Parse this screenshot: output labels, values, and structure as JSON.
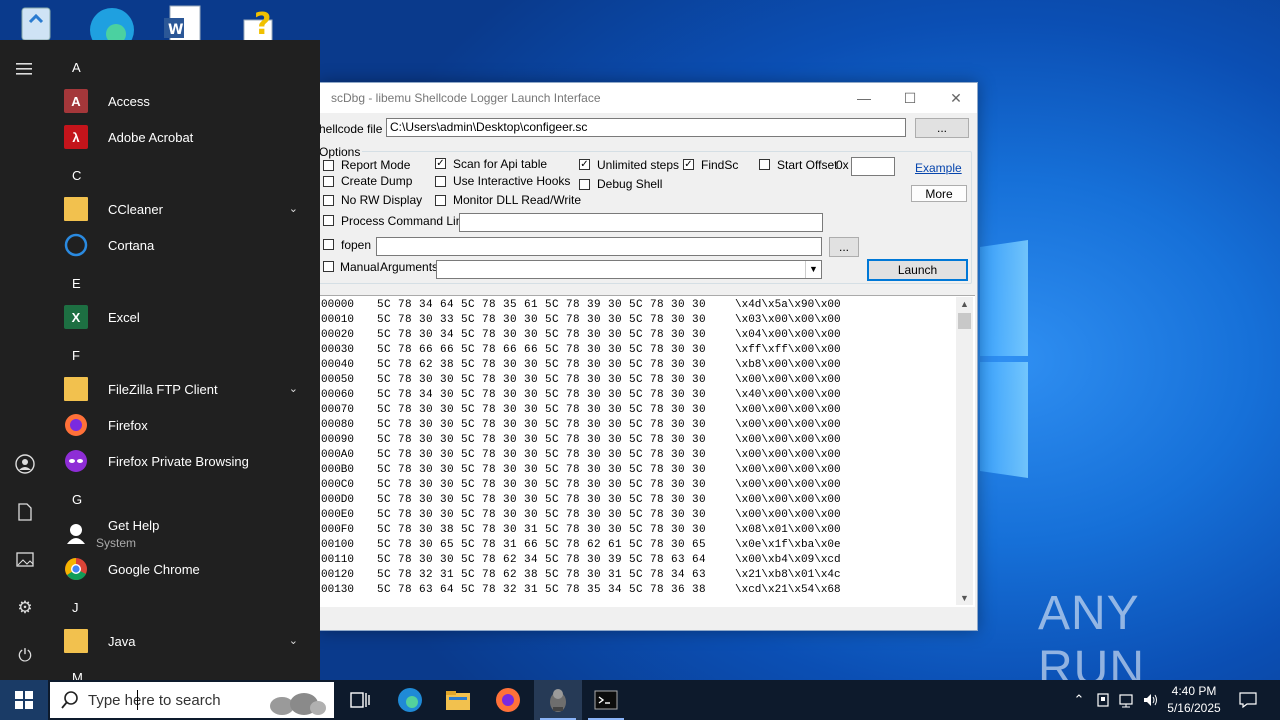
{
  "window": {
    "title": "scDbg - libemu Shellcode Logger Launch Interface",
    "shellcode_label": "hellcode file",
    "shellcode_path": "C:\\Users\\admin\\Desktop\\configeer.sc",
    "browse_label": "...",
    "options_label": "Options",
    "checkboxes": [
      {
        "label": "Report Mode",
        "checked": false
      },
      {
        "label": "Create Dump",
        "checked": false
      },
      {
        "label": "No RW Display",
        "checked": false
      },
      {
        "label": "Scan for Api table",
        "checked": true
      },
      {
        "label": "Use Interactive Hooks",
        "checked": false
      },
      {
        "label": "Monitor DLL Read/Write",
        "checked": false
      },
      {
        "label": "Unlimited steps",
        "checked": true
      },
      {
        "label": "Debug Shell",
        "checked": false
      },
      {
        "label": "FindSc",
        "checked": true
      },
      {
        "label": "Start Offset",
        "checked": false
      },
      {
        "label": "Process Command Line",
        "checked": false
      },
      {
        "label": "fopen",
        "checked": false
      },
      {
        "label": "Manual",
        "checked": false
      }
    ],
    "offset_prefix": "0x",
    "offset_value": "",
    "example_link": "Example",
    "more_button": "More",
    "cmdline_value": "",
    "fopen_value": "",
    "fopen_browse": "...",
    "arguments_label": "Arguments",
    "arguments_value": "",
    "launch_button": "Launch",
    "hex_rows": [
      [
        "00000",
        "5C 78 34 64 5C 78 35 61 5C 78 39 30 5C 78 30 30",
        "\\x4d\\x5a\\x90\\x00"
      ],
      [
        "00010",
        "5C 78 30 33 5C 78 30 30 5C 78 30 30 5C 78 30 30",
        "\\x03\\x00\\x00\\x00"
      ],
      [
        "00020",
        "5C 78 30 34 5C 78 30 30 5C 78 30 30 5C 78 30 30",
        "\\x04\\x00\\x00\\x00"
      ],
      [
        "00030",
        "5C 78 66 66 5C 78 66 66 5C 78 30 30 5C 78 30 30",
        "\\xff\\xff\\x00\\x00"
      ],
      [
        "00040",
        "5C 78 62 38 5C 78 30 30 5C 78 30 30 5C 78 30 30",
        "\\xb8\\x00\\x00\\x00"
      ],
      [
        "00050",
        "5C 78 30 30 5C 78 30 30 5C 78 30 30 5C 78 30 30",
        "\\x00\\x00\\x00\\x00"
      ],
      [
        "00060",
        "5C 78 34 30 5C 78 30 30 5C 78 30 30 5C 78 30 30",
        "\\x40\\x00\\x00\\x00"
      ],
      [
        "00070",
        "5C 78 30 30 5C 78 30 30 5C 78 30 30 5C 78 30 30",
        "\\x00\\x00\\x00\\x00"
      ],
      [
        "00080",
        "5C 78 30 30 5C 78 30 30 5C 78 30 30 5C 78 30 30",
        "\\x00\\x00\\x00\\x00"
      ],
      [
        "00090",
        "5C 78 30 30 5C 78 30 30 5C 78 30 30 5C 78 30 30",
        "\\x00\\x00\\x00\\x00"
      ],
      [
        "000A0",
        "5C 78 30 30 5C 78 30 30 5C 78 30 30 5C 78 30 30",
        "\\x00\\x00\\x00\\x00"
      ],
      [
        "000B0",
        "5C 78 30 30 5C 78 30 30 5C 78 30 30 5C 78 30 30",
        "\\x00\\x00\\x00\\x00"
      ],
      [
        "000C0",
        "5C 78 30 30 5C 78 30 30 5C 78 30 30 5C 78 30 30",
        "\\x00\\x00\\x00\\x00"
      ],
      [
        "000D0",
        "5C 78 30 30 5C 78 30 30 5C 78 30 30 5C 78 30 30",
        "\\x00\\x00\\x00\\x00"
      ],
      [
        "000E0",
        "5C 78 30 30 5C 78 30 30 5C 78 30 30 5C 78 30 30",
        "\\x00\\x00\\x00\\x00"
      ],
      [
        "000F0",
        "5C 78 30 38 5C 78 30 31 5C 78 30 30 5C 78 30 30",
        "\\x08\\x01\\x00\\x00"
      ],
      [
        "00100",
        "5C 78 30 65 5C 78 31 66 5C 78 62 61 5C 78 30 65",
        "\\x0e\\x1f\\xba\\x0e"
      ],
      [
        "00110",
        "5C 78 30 30 5C 78 62 34 5C 78 30 39 5C 78 63 64",
        "\\x00\\xb4\\x09\\xcd"
      ],
      [
        "00120",
        "5C 78 32 31 5C 78 62 38 5C 78 30 31 5C 78 34 63",
        "\\x21\\xb8\\x01\\x4c"
      ],
      [
        "00130",
        "5C 78 63 64 5C 78 32 31 5C 78 35 34 5C 78 36 38",
        "\\xcd\\x21\\x54\\x68"
      ]
    ]
  },
  "start_menu": {
    "letters": [
      "A",
      "C",
      "E",
      "F",
      "G",
      "J",
      "M"
    ],
    "apps": [
      {
        "name": "Access",
        "icon": "access-icon",
        "color": "#a4373a"
      },
      {
        "name": "Adobe Acrobat",
        "icon": "acrobat-icon",
        "color": "#c4141b"
      },
      {
        "name": "CCleaner",
        "icon": "folder-icon",
        "color": "#f2c14e"
      },
      {
        "name": "Cortana",
        "icon": "cortana-icon",
        "color": "#2a8ae0"
      },
      {
        "name": "Excel",
        "icon": "excel-icon",
        "color": "#1d6f42"
      },
      {
        "name": "FileZilla FTP Client",
        "icon": "folder-icon",
        "color": "#f2c14e"
      },
      {
        "name": "Firefox",
        "icon": "firefox-icon",
        "color": "#ff7139"
      },
      {
        "name": "Firefox Private Browsing",
        "icon": "firefox-private-icon",
        "color": "#8e2dd6"
      },
      {
        "name": "Get Help",
        "sub": "System",
        "icon": "get-help-icon",
        "color": "#2a8ae0"
      },
      {
        "name": "Google Chrome",
        "icon": "chrome-icon",
        "color": "#4285f4"
      },
      {
        "name": "Java",
        "icon": "folder-icon",
        "color": "#f2c14e"
      }
    ]
  },
  "taskbar": {
    "search_placeholder": "Type here to search",
    "time": "4:40 PM",
    "date": "5/16/2025"
  },
  "watermark": "ANY RUN"
}
